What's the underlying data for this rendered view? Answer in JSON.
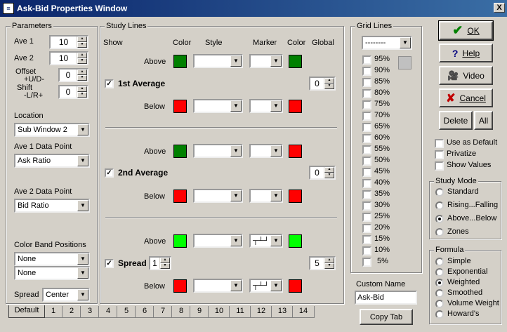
{
  "window": {
    "title": "Ask-Bid Properties Window",
    "close": "X"
  },
  "parameters": {
    "group_label": "Parameters",
    "ave1_label": "Ave 1",
    "ave1_value": "10",
    "ave2_label": "Ave 2",
    "ave2_value": "10",
    "offset_label_1": "Offset",
    "offset_label_2": "+U/D-",
    "offset_value": "0",
    "shift_label_1": "Shift",
    "shift_label_2": "-L/R+",
    "shift_value": "0",
    "location_label": "Location",
    "location_value": "Sub Window  2",
    "ave1_dp_label": "Ave 1 Data Point",
    "ave1_dp_value": "Ask Ratio",
    "ave2_dp_label": "Ave 2 Data Point",
    "ave2_dp_value": "Bid Ratio",
    "color_band_label": "Color Band Positions",
    "color_band_1": "None",
    "color_band_2": "None",
    "spread_label": "Spread",
    "spread_value": "Center"
  },
  "study_lines": {
    "group_label": "Study Lines",
    "headers": {
      "show": "Show",
      "color": "Color",
      "style": "Style",
      "marker": "Marker",
      "color2": "Color",
      "global": "Global"
    },
    "above": "Above",
    "below": "Below",
    "sections": [
      {
        "name": "1st Average",
        "checked": "✓",
        "global": "0",
        "above_color": "#008000",
        "above_color2": "#008000",
        "below_color": "#ff0000",
        "below_color2": "#ff0000"
      },
      {
        "name": "2nd Average",
        "checked": "✓",
        "global": "0",
        "above_color": "#008000",
        "above_color2": "#ff0000",
        "below_color": "#ff0000",
        "below_color2": "#ff0000"
      },
      {
        "name": "Spread",
        "checked": "✓",
        "spin": "1",
        "global": "5",
        "above_color": "#00ff00",
        "above_color2": "#00ff00",
        "below_color": "#ff0000",
        "below_color2": "#ff0000"
      }
    ]
  },
  "grid_lines": {
    "group_label": "Grid Lines",
    "style_value": "--------",
    "levels": [
      "95%",
      "90%",
      "85%",
      "80%",
      "75%",
      "70%",
      "65%",
      "60%",
      "55%",
      "50%",
      "45%",
      "40%",
      "35%",
      "30%",
      "25%",
      "20%",
      "15%",
      "10%",
      "5%"
    ]
  },
  "buttons": {
    "ok": "OK",
    "help": "Help",
    "video": "Video",
    "cancel": "Cancel",
    "delete": "Delete",
    "all": "All",
    "copy_tab": "Copy Tab"
  },
  "options": {
    "use_default": "Use as Default",
    "privatize": "Privatize",
    "show_values": "Show Values"
  },
  "study_mode": {
    "label": "Study Mode",
    "items": [
      "Standard",
      "Rising...Falling",
      "Above...Below",
      "Zones"
    ],
    "selected": "Above...Below"
  },
  "formula": {
    "label": "Formula",
    "items": [
      "Simple",
      "Exponential",
      "Weighted",
      "Smoothed",
      "Volume Weight",
      "Howard's"
    ],
    "selected": "Weighted"
  },
  "custom_name": {
    "label": "Custom Name",
    "value": "Ask-Bid"
  },
  "tabs": [
    "Default",
    "1",
    "2",
    "3",
    "4",
    "5",
    "6",
    "7",
    "8",
    "9",
    "10",
    "11",
    "12",
    "13",
    "14"
  ]
}
